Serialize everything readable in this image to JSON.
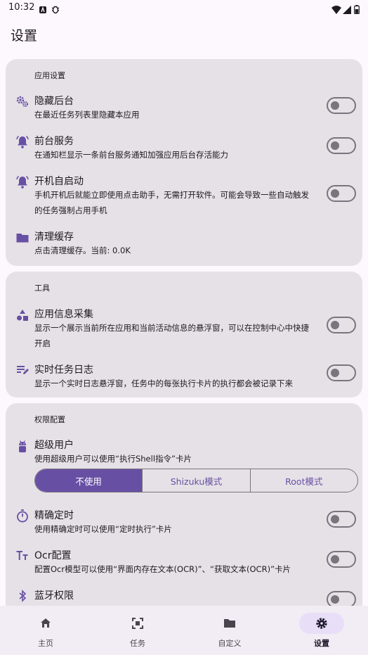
{
  "status_bar": {
    "time": "10:32"
  },
  "page": {
    "title": "设置"
  },
  "app_settings": {
    "section_title": "应用设置",
    "items": [
      {
        "title": "隐藏后台",
        "desc": "在最近任务列表里隐藏本应用",
        "icon": "gears-icon",
        "toggle": false
      },
      {
        "title": "前台服务",
        "desc": "在通知栏显示一条前台服务通知加强应用后台存活能力",
        "icon": "bell-icon",
        "toggle": false
      },
      {
        "title": "开机自启动",
        "desc_line1": "手机开机后就能立即使用点击助手，无需打开软件。可能会导致一些自动触发",
        "desc_line2": "的任务强制占用手机",
        "icon": "bell-icon",
        "toggle": false
      },
      {
        "title": "清理缓存",
        "desc": "点击清理缓存。当前: 0.0K",
        "icon": "folder-icon"
      }
    ]
  },
  "tools": {
    "section_title": "工具",
    "items": [
      {
        "title": "应用信息采集",
        "desc_line1": "显示一个展示当前所在应用和当前活动信息的悬浮窗，可以在控制中心中快捷",
        "desc_line2": "开启",
        "icon": "shapes-icon",
        "toggle": false
      },
      {
        "title": "实时任务日志",
        "desc": "显示一个实时日志悬浮窗，任务中的每张执行卡片的执行都会被记录下来",
        "icon": "log-icon",
        "toggle": false
      }
    ]
  },
  "permissions": {
    "section_title": "权限配置",
    "superuser": {
      "title": "超级用户",
      "desc": "使用超级用户可以使用“执行Shell指令”卡片",
      "icon": "android-icon",
      "options": [
        "不使用",
        "Shizuku模式",
        "Root模式"
      ],
      "selected": "不使用"
    },
    "items": [
      {
        "title": "精确定时",
        "desc": "使用精确定时可以使用“定时执行”卡片",
        "icon": "timer-icon",
        "toggle": false
      },
      {
        "title": "Ocr配置",
        "desc": "配置Ocr模型可以使用“界面内存在文本(OCR)”、“获取文本(OCR)”卡片",
        "icon": "text-size-icon",
        "toggle": false
      },
      {
        "title": "蓝牙权限",
        "icon": "bluetooth-icon",
        "toggle": false
      }
    ]
  },
  "bottom_nav": {
    "items": [
      {
        "label": "主页",
        "icon": "home-icon"
      },
      {
        "label": "任务",
        "icon": "task-icon"
      },
      {
        "label": "自定义",
        "icon": "folder-icon"
      },
      {
        "label": "设置",
        "icon": "gear-icon"
      }
    ],
    "active": "设置"
  },
  "colors": {
    "accent": "#6750a4",
    "card": "#e6e1e6",
    "background": "#fdf8fd"
  }
}
